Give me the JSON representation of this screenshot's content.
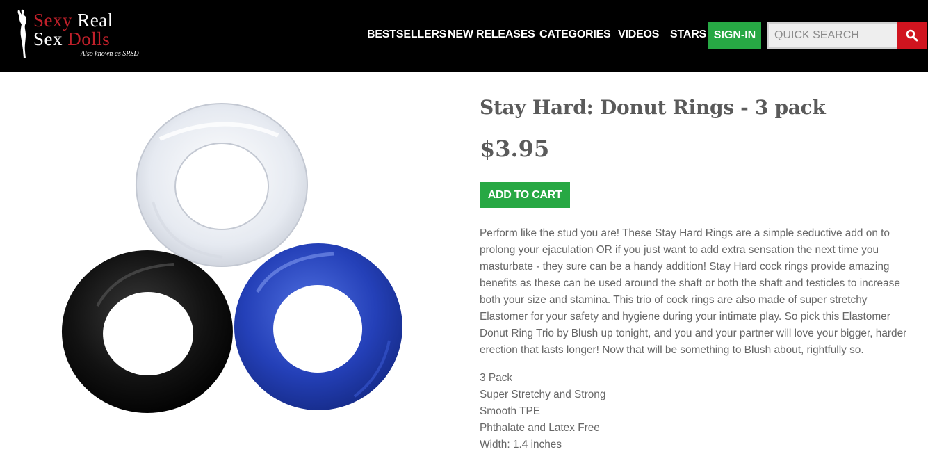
{
  "header": {
    "logo": {
      "line1_red": "Sexy",
      "line1_white": "Real",
      "line2_white": "Sex",
      "line2_red": "Dolls",
      "tagline": "Also known as SRSD"
    },
    "nav": [
      {
        "label": "BESTSELLERS"
      },
      {
        "label": "NEW RELEASES"
      },
      {
        "label": "CATEGORIES"
      },
      {
        "label": "VIDEOS"
      },
      {
        "label": "STARS"
      }
    ],
    "signin_label": "SIGN-IN",
    "search": {
      "placeholder": "QUICK SEARCH",
      "value": ""
    },
    "icons": {
      "search": "search-icon",
      "logo_figure": "silhouette-figure-icon"
    }
  },
  "product": {
    "title": "Stay Hard: Donut Rings - 3 pack",
    "price": "$3.95",
    "add_to_cart_label": "ADD TO CART",
    "description": "Perform like the stud you are! These Stay Hard Rings are a simple seductive add on to prolong your ejaculation OR if you just want to add extra sensation the next time you masturbate - they sure can be a handy addition! Stay Hard cock rings provide amazing benefits as these can be used around the shaft or both the shaft and testicles to increase both your size and stamina. This trio of cock rings are also made of super stretchy Elastomer for your safety and hygiene during your intimate play. So pick this Elastomer Donut Ring Trio by Blush up tonight, and you and your partner will love your bigger, harder erection that lasts longer! Now that will be something to Blush about, rightfully so.",
    "features": [
      "3 Pack",
      "Super Stretchy and Strong",
      "Smooth TPE",
      "Phthalate and Latex Free",
      "Width: 1.4 inches"
    ],
    "ring_colors": {
      "clear": "#e8ecf2",
      "black": "#111111",
      "blue": "#1f3bb0"
    }
  },
  "colors": {
    "header_bg": "#000000",
    "green": "#27a844",
    "red": "#d0141f",
    "text": "#5a5a5a"
  }
}
